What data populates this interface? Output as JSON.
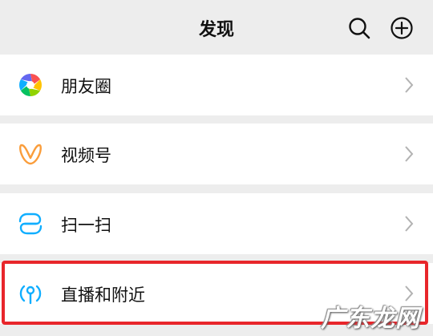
{
  "header": {
    "title": "发现",
    "search_icon": "search-icon",
    "add_icon": "plus-circle-icon"
  },
  "items": [
    {
      "label": "朋友圈",
      "icon": "moments-shutter-icon"
    },
    {
      "label": "视频号",
      "icon": "channels-butterfly-icon"
    },
    {
      "label": "扫一扫",
      "icon": "scan-icon"
    },
    {
      "label": "直播和附近",
      "icon": "live-nearby-icon"
    }
  ],
  "highlight_color": "#e8262b",
  "watermark": "广东龙网"
}
